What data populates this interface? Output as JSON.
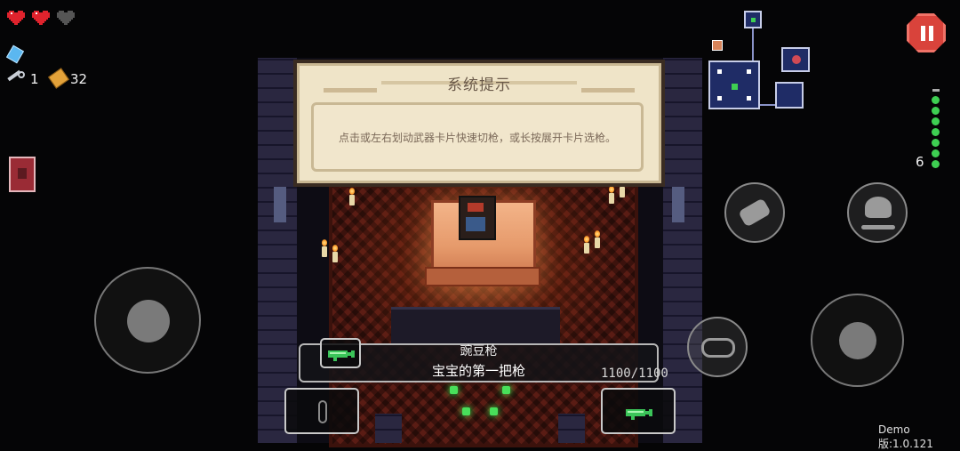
{
  "dialog": {
    "title": "系统提示",
    "message": "点击或左右划动武器卡片快速切枪，或长按展开卡片选枪。"
  },
  "hud": {
    "hearts": [
      "full",
      "full",
      "empty"
    ],
    "keys": "1",
    "shells": "32",
    "blanks_remaining": 6,
    "blank_pips": 8
  },
  "weapon": {
    "name": "豌豆枪",
    "description": "宝宝的第一把枪",
    "ammo": "1100/1100"
  },
  "version": "Demo版:1.0.121",
  "colors": {
    "pause_red": "#d9433b",
    "dialog_bg": "#efe4c8",
    "pip_green": "#3ecf52"
  },
  "icons": {
    "pause": "pause-icon",
    "heart": "heart-icon",
    "key": "key-icon",
    "shell": "shell-casing-icon",
    "blank": "blank-icon",
    "dodge": "dodge-roll-icon",
    "active": "active-item-icon",
    "reload": "reload-icon"
  }
}
